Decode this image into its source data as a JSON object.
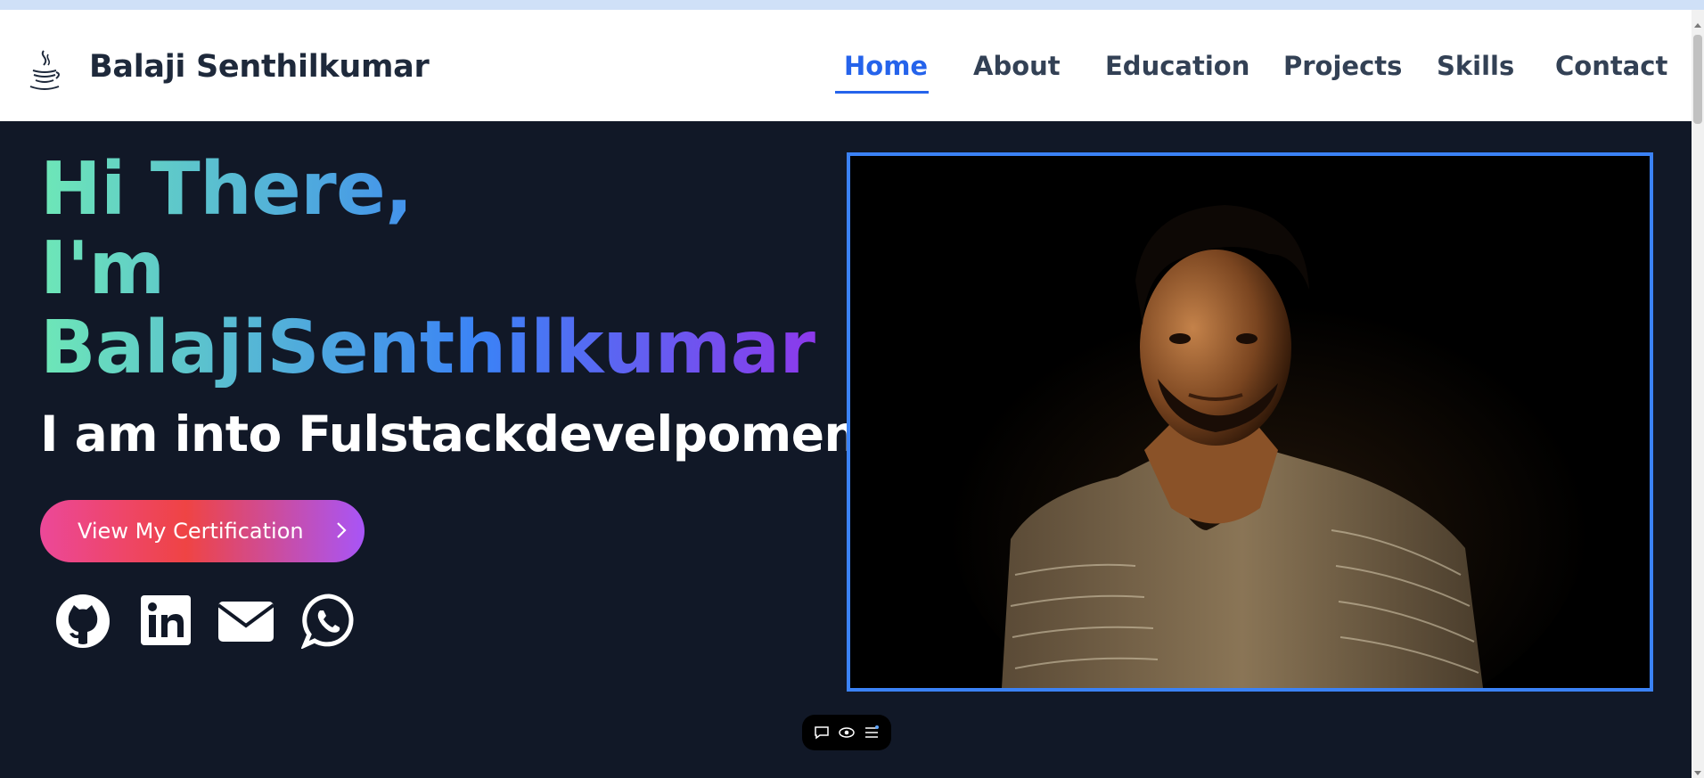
{
  "brand": {
    "name": "Balaji Senthilkumar",
    "logo_icon": "java-coffee-cup-icon"
  },
  "nav": {
    "links": [
      {
        "label": "Home",
        "active": true
      },
      {
        "label": "About",
        "active": false
      },
      {
        "label": "Education",
        "active": false
      },
      {
        "label": "Projects",
        "active": false
      },
      {
        "label": "Skills",
        "active": false
      },
      {
        "label": "Contact",
        "active": false
      }
    ]
  },
  "hero": {
    "line1": "Hi There,",
    "line2": "I'm",
    "line3": "BalajiSenthilkumar",
    "subtitle": "I am into Fulstackdevelpoment",
    "cta_label": "View My Certification",
    "social": [
      {
        "icon": "github-icon"
      },
      {
        "icon": "linkedin-icon"
      },
      {
        "icon": "mail-icon"
      },
      {
        "icon": "whatsapp-icon"
      }
    ]
  },
  "photo": {
    "alt": "portrait-photo"
  },
  "toolbar": {
    "icons": [
      "comment-icon",
      "eye-icon",
      "menu-icon"
    ]
  },
  "colors": {
    "accent": "#2563eb",
    "hero_bg": "#111827",
    "frame_border": "#3b82f6",
    "gradient_start": "#6ee7b7",
    "gradient_mid": "#3b82f6",
    "gradient_end": "#9333ea",
    "button_start": "#ec4899",
    "button_mid": "#ef4444",
    "button_end": "#a855f7"
  }
}
